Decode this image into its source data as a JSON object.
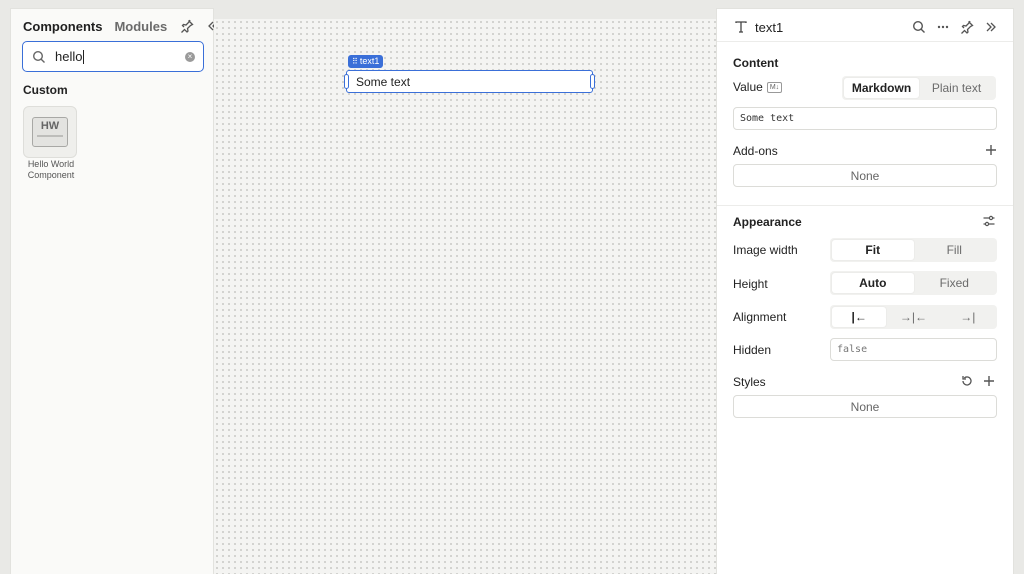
{
  "left_panel": {
    "tabs": [
      "Components",
      "Modules"
    ],
    "search": {
      "value": "hello"
    },
    "section_title": "Custom",
    "component": {
      "icon_text": "HW",
      "label_line1": "Hello World",
      "label_line2": "Component"
    }
  },
  "canvas": {
    "selection_tag": "text1",
    "text_component_value": "Some text"
  },
  "right_panel": {
    "title": "text1",
    "content": {
      "section_title": "Content",
      "value_label": "Value",
      "value_badge": "M↓",
      "format_options": [
        "Markdown",
        "Plain text"
      ],
      "format_selected": "Markdown",
      "value_input": "Some text",
      "addons_label": "Add-ons",
      "addons_value": "None"
    },
    "appearance": {
      "section_title": "Appearance",
      "image_width_label": "Image width",
      "image_width_options": [
        "Fit",
        "Fill"
      ],
      "height_label": "Height",
      "height_options": [
        "Auto",
        "Fixed"
      ],
      "alignment_label": "Alignment",
      "alignment_options": [
        "|←",
        "→|←",
        "→|"
      ],
      "hidden_label": "Hidden",
      "hidden_value": "false",
      "styles_label": "Styles",
      "styles_value": "None"
    }
  },
  "colors": {
    "accent": "#3a6fd8",
    "canvas_bg": "#f4f4f2",
    "panel_bg": "#fafaf8"
  }
}
